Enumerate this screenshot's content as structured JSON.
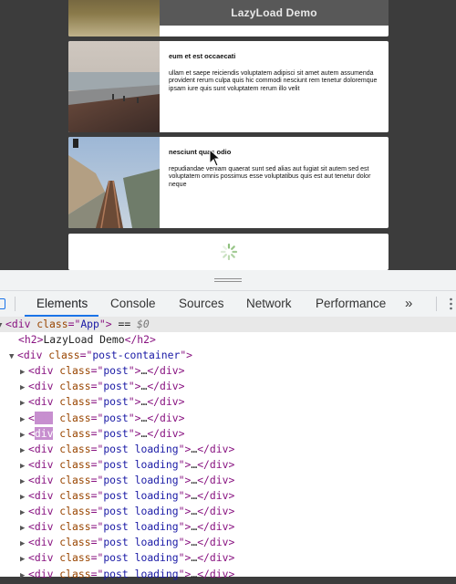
{
  "app": {
    "header_title": "LazyLoad Demo",
    "posts": [
      {
        "title": "eum et est occaecati",
        "body": "ullam et saepe reiciendis voluptatem adipisci sit amet autem assumenda provident rerum culpa quis hic commodi nesciunt rem tenetur doloremque ipsam iure quis sunt voluptatem rerum illo velit",
        "image": "beach-scene"
      },
      {
        "title": "nesciunt quas odio",
        "body": "repudiandae veniam quaerat sunt sed alias aut fugiat sit autem sed est voluptatem omnis possimus esse voluptatibus quis est aut tenetur dolor neque",
        "image": "railroad-tracks"
      }
    ],
    "loading_indicator": "spinner-icon"
  },
  "devtools": {
    "tabs": [
      "Elements",
      "Console",
      "Sources",
      "Network",
      "Performance"
    ],
    "active_tab": "Elements",
    "more_label": "»",
    "tree": {
      "root_line": {
        "tag": "div",
        "attr": "class",
        "value": "App",
        "suffix": " == ",
        "ref": "$0"
      },
      "h2_line": {
        "open": "<h2>",
        "text": "LazyLoad Demo",
        "close": "</h2>"
      },
      "container_line": {
        "tag": "div",
        "attr": "class",
        "value": "post-container"
      },
      "children": [
        {
          "tag": "div",
          "value": "post",
          "ellipsis": "…"
        },
        {
          "tag": "div",
          "value": "post",
          "ellipsis": "…"
        },
        {
          "tag": "div",
          "value": "post",
          "ellipsis": "…"
        },
        {
          "tag": "div",
          "value": "post",
          "ellipsis": "…",
          "highlight": "full"
        },
        {
          "tag": "div",
          "value": "post",
          "ellipsis": "…",
          "highlight": "tag"
        },
        {
          "tag": "div",
          "value": "post loading",
          "ellipsis": "…"
        },
        {
          "tag": "div",
          "value": "post loading",
          "ellipsis": "…"
        },
        {
          "tag": "div",
          "value": "post loading",
          "ellipsis": "…"
        },
        {
          "tag": "div",
          "value": "post loading",
          "ellipsis": "…"
        },
        {
          "tag": "div",
          "value": "post loading",
          "ellipsis": "…"
        },
        {
          "tag": "div",
          "value": "post loading",
          "ellipsis": "…"
        },
        {
          "tag": "div",
          "value": "post loading",
          "ellipsis": "…"
        },
        {
          "tag": "div",
          "value": "post loading",
          "ellipsis": "…"
        },
        {
          "tag": "div",
          "value": "post loading",
          "ellipsis": "…"
        }
      ]
    }
  },
  "colors": {
    "accent": "#1a73e8",
    "tag": "#881280",
    "attr": "#994500",
    "value": "#1a1aa6",
    "highlight": "#c78fcf"
  }
}
